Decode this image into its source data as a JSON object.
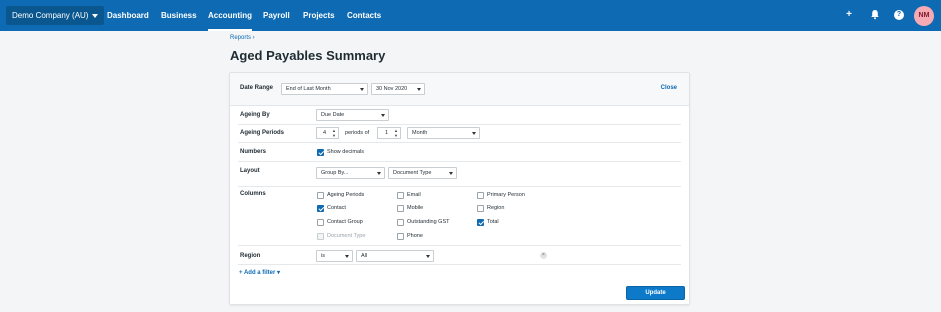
{
  "header": {
    "org_name": "Demo Company (AU)",
    "nav": [
      "Dashboard",
      "Business",
      "Accounting",
      "Payroll",
      "Projects",
      "Contacts"
    ],
    "active_nav": "Accounting",
    "avatar_initials": "NM",
    "icons": [
      "plus-icon",
      "bell-icon",
      "help-icon"
    ],
    "plus_glyph": "+",
    "help_glyph": "?"
  },
  "breadcrumb": "Reports ›",
  "page_title": "Aged Payables Summary",
  "form": {
    "date_range_label": "Date Range",
    "date_range_value": "End of Last Month",
    "date_value": "30 Nov 2020",
    "close_label": "Close",
    "ageing_by_label": "Ageing By",
    "ageing_by_value": "Due Date",
    "ageing_periods_label": "Ageing Periods",
    "periods_count": "4",
    "periods_of_text": "periods of",
    "period_length": "1",
    "period_unit": "Month",
    "numbers_label": "Numbers",
    "show_decimals_label": "Show decimals",
    "layout_label": "Layout",
    "group_by_value": "Group By...",
    "document_type_value": "Document Type",
    "columns_label": "Columns",
    "columns": [
      {
        "label": "Ageing Periods",
        "checked": false,
        "disabled": false
      },
      {
        "label": "Contact",
        "checked": true,
        "disabled": false
      },
      {
        "label": "Contact Group",
        "checked": false,
        "disabled": false
      },
      {
        "label": "Document Type",
        "checked": false,
        "disabled": true
      },
      {
        "label": "Email",
        "checked": false,
        "disabled": false
      },
      {
        "label": "Mobile",
        "checked": false,
        "disabled": false
      },
      {
        "label": "Outstanding GST",
        "checked": false,
        "disabled": false
      },
      {
        "label": "Phone",
        "checked": false,
        "disabled": false
      },
      {
        "label": "Primary Person",
        "checked": false,
        "disabled": false
      },
      {
        "label": "Region",
        "checked": false,
        "disabled": false
      },
      {
        "label": "Total",
        "checked": true,
        "disabled": false
      }
    ],
    "region_label": "Region",
    "region_operator": "is",
    "region_value": "All",
    "add_filter_label": "+ Add a filter ▾",
    "update_label": "Update"
  },
  "colors": {
    "topbar": "#0d6ab3",
    "accent": "#0d7ac9",
    "avatar_bg": "#f7a9b4"
  }
}
